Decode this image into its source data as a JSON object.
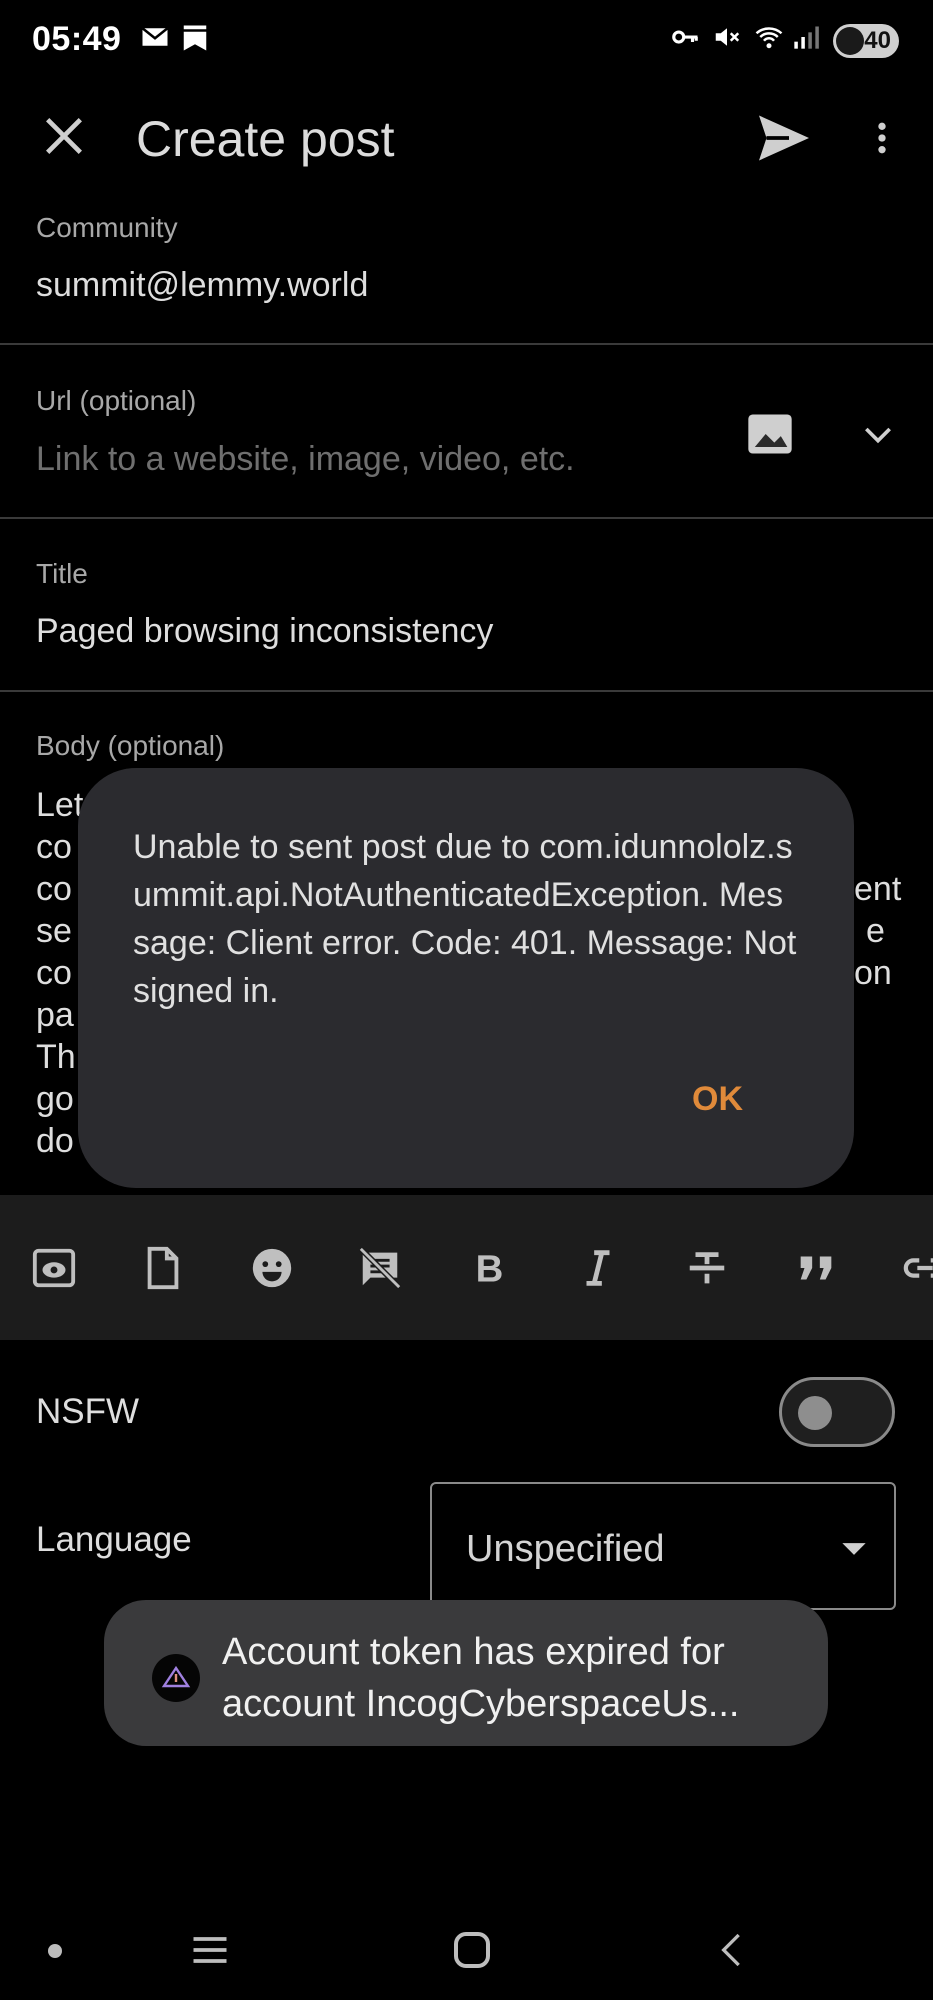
{
  "status_bar": {
    "time": "05:49",
    "battery": "40",
    "icons": [
      "mail-icon",
      "bookmark-stack-icon",
      "vpn-key-icon",
      "mute-icon",
      "wifi-icon",
      "signal-icon",
      "battery-icon"
    ]
  },
  "app_bar": {
    "title": "Create post",
    "icons": [
      "close-icon",
      "send-icon",
      "more-vert-icon"
    ]
  },
  "form": {
    "community_label": "Community",
    "community_value": "summit@lemmy.world",
    "url_label": "Url (optional)",
    "url_placeholder": "Link to a website, image, video, etc.",
    "title_label": "Title",
    "title_value": "Paged browsing inconsistency",
    "body_label": "Body (optional)",
    "body_visible_left": [
      "Let",
      "co",
      "co",
      "se",
      "co",
      "pa",
      "Th",
      "go",
      "do"
    ],
    "body_visible_right": [
      "ent",
      "e",
      "on"
    ]
  },
  "dialog": {
    "message": "Unable to sent post due to com.idunnololz.summit.api.NotAuthenticatedException. Message: Client error. Code: 401. Message: Not signed in.",
    "ok_label": "OK"
  },
  "toolbar": {
    "icons": [
      "preview-icon",
      "file-icon",
      "emoji-icon",
      "hide-comment-icon",
      "bold-icon",
      "italic-icon",
      "strikethrough-icon",
      "quote-icon",
      "link-icon"
    ]
  },
  "options": {
    "nsfw_label": "NSFW",
    "nsfw_enabled": false,
    "language_label": "Language",
    "language_value": "Unspecified"
  },
  "snackbar": {
    "text": "Account token has expired for account IncogCyberspaceUs..."
  },
  "colors": {
    "background": "#000000",
    "dialog_bg": "#2b2b2f",
    "accent": "#e08a3a",
    "toolbar_bg": "#1c1c1c",
    "snackbar_bg": "#3a3a3c"
  }
}
